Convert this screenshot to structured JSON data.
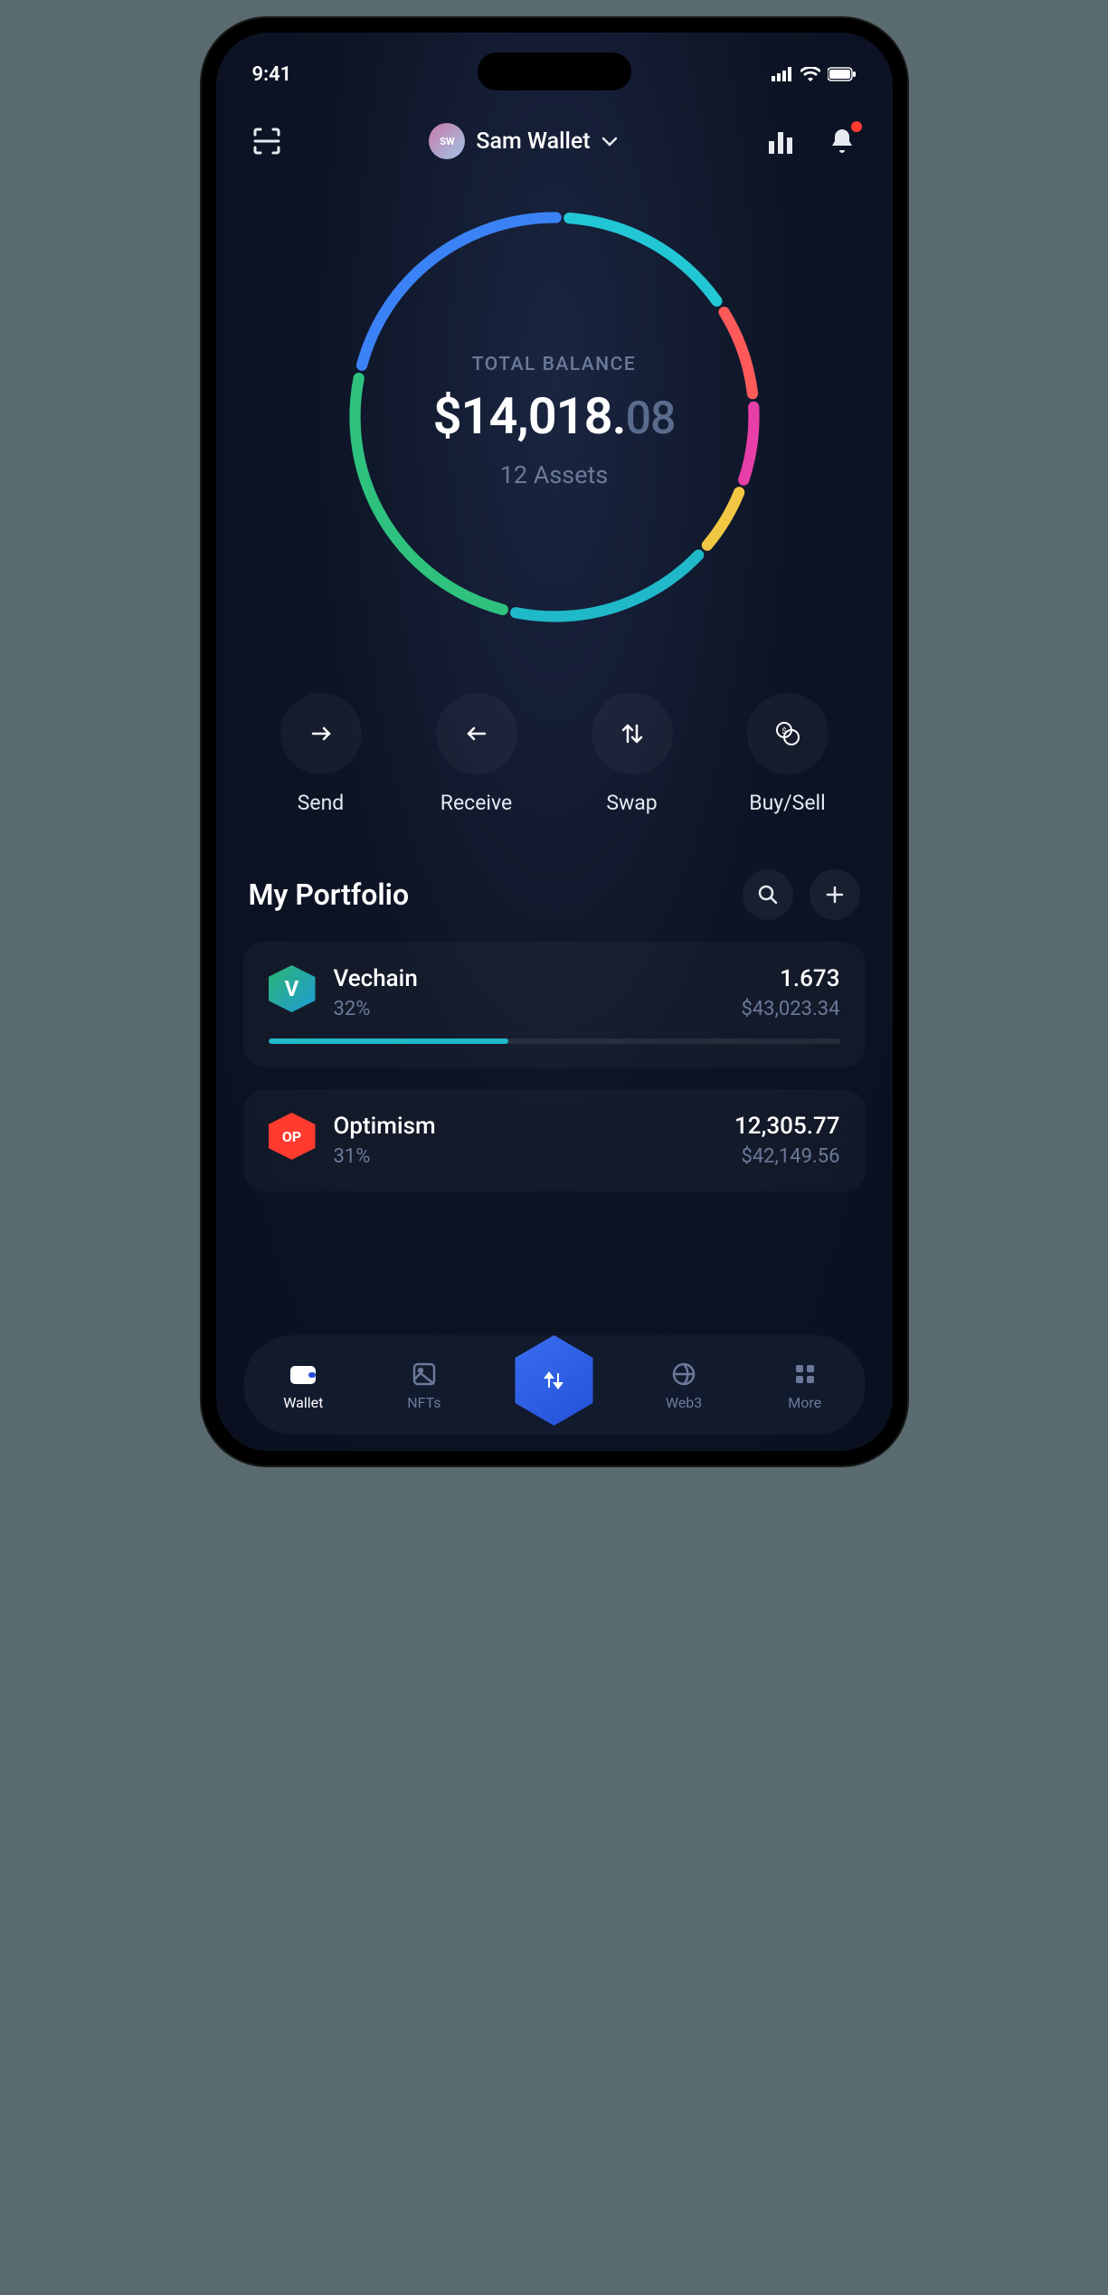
{
  "status_bar": {
    "time": "9:41"
  },
  "header": {
    "wallet_initials": "SW",
    "wallet_name": "Sam Wallet"
  },
  "balance": {
    "label": "TOTAL BALANCE",
    "amount_main": "$14,018.",
    "amount_cents": "08",
    "assets_text": "12 Assets"
  },
  "chart_data": {
    "type": "donut",
    "title": "Portfolio allocation",
    "series": [
      {
        "name": "segment-green",
        "pct": 25,
        "color": "#2ec27e"
      },
      {
        "name": "segment-blue",
        "pct": 22,
        "color": "#3b82f6"
      },
      {
        "name": "segment-teal-lt",
        "pct": 15,
        "color": "#22c7d6"
      },
      {
        "name": "segment-red",
        "pct": 8,
        "color": "#ff5a5a"
      },
      {
        "name": "segment-magenta",
        "pct": 7,
        "color": "#e83ea8"
      },
      {
        "name": "segment-yellow",
        "pct": 6,
        "color": "#f2c744"
      },
      {
        "name": "segment-teal",
        "pct": 17,
        "color": "#1fb9c9"
      }
    ]
  },
  "actions": {
    "send": "Send",
    "receive": "Receive",
    "swap": "Swap",
    "buysell": "Buy/Sell"
  },
  "portfolio": {
    "title": "My Portfolio",
    "assets": [
      {
        "name": "Vechain",
        "pct": "32%",
        "qty": "1.673",
        "value": "$43,023.34",
        "bar_pct": 42,
        "bar_color": "#1fb9c9",
        "icon_bg": "linear-gradient(135deg,#2bb673,#1e9bd6)",
        "icon_letter": "V",
        "icon_shape": "hex"
      },
      {
        "name": "Optimism",
        "pct": "31%",
        "qty": "12,305.77",
        "value": "$42,149.56",
        "bar_pct": 0,
        "bar_color": "#ff3b30",
        "icon_bg": "#ff3b30",
        "icon_letter": "OP",
        "icon_shape": "hex"
      }
    ]
  },
  "nav": {
    "wallet": "Wallet",
    "nfts": "NFTs",
    "web3": "Web3",
    "more": "More"
  }
}
